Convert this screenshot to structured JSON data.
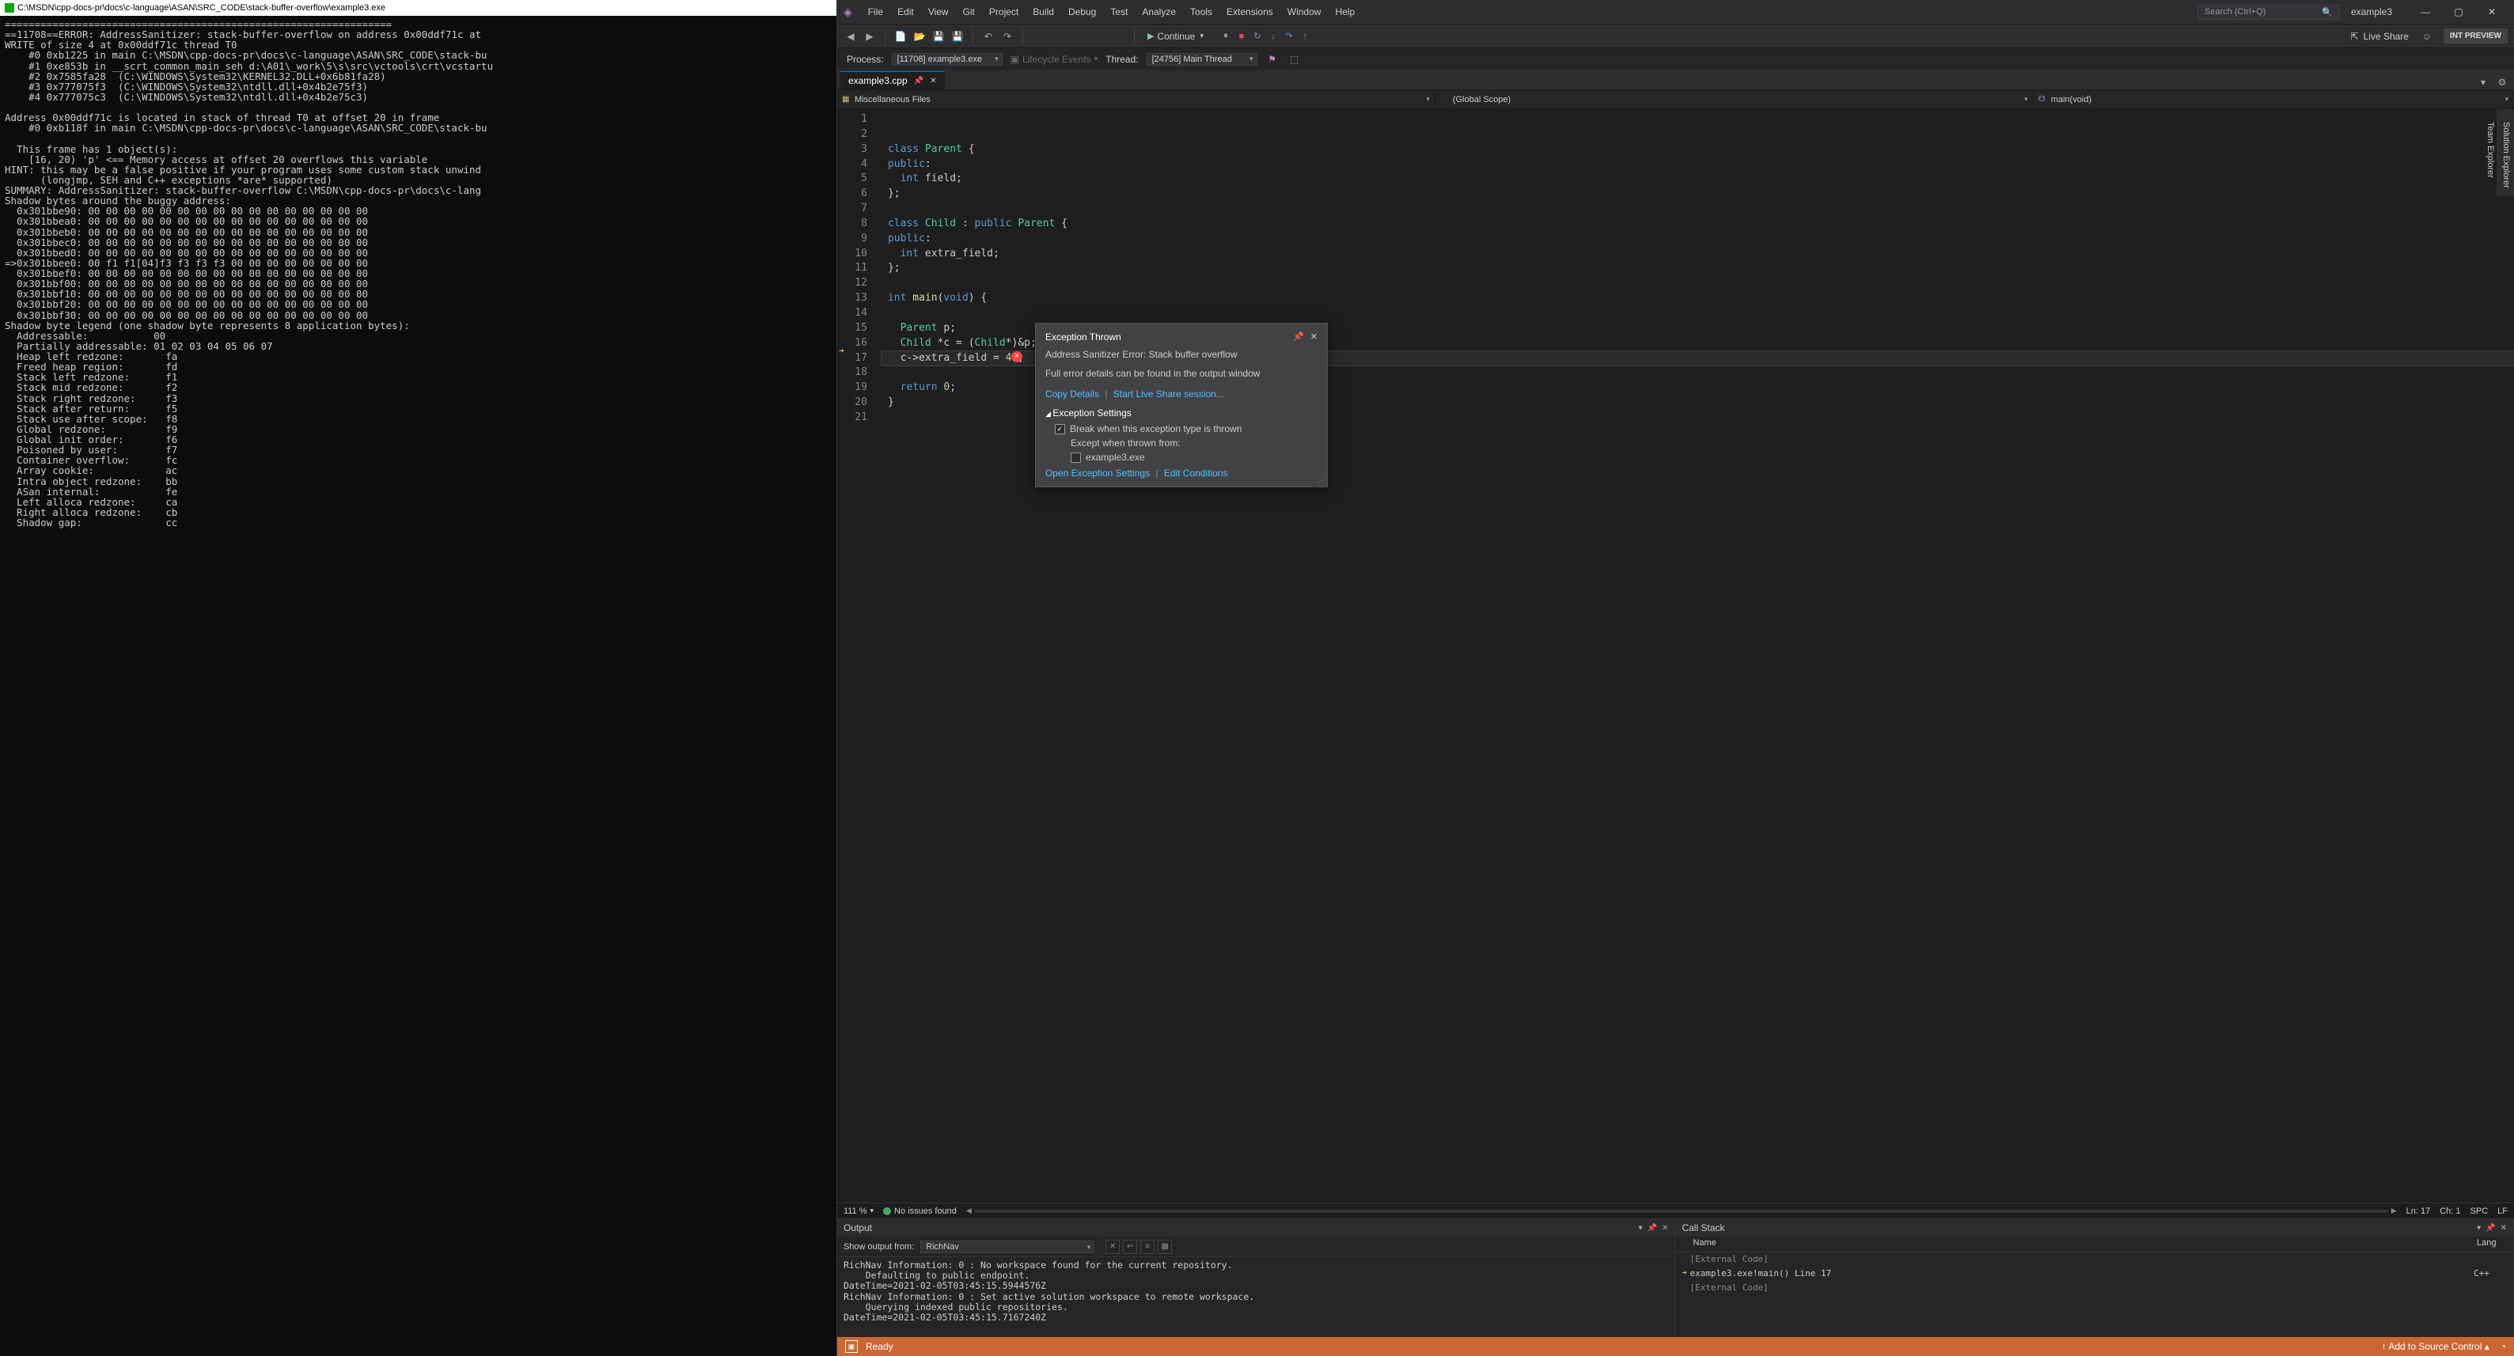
{
  "console": {
    "title": "C:\\MSDN\\cpp-docs-pr\\docs\\c-language\\ASAN\\SRC_CODE\\stack-buffer-overflow\\example3.exe",
    "body": "=================================================================\n==11708==ERROR: AddressSanitizer: stack-buffer-overflow on address 0x00ddf71c at \nWRITE of size 4 at 0x00ddf71c thread T0\n    #0 0xb1225 in main C:\\MSDN\\cpp-docs-pr\\docs\\c-language\\ASAN\\SRC_CODE\\stack-bu\n    #1 0xe853b in __scrt_common_main_seh d:\\A01\\_work\\5\\s\\src\\vctools\\crt\\vcstartu\n    #2 0x7585fa28  (C:\\WINDOWS\\System32\\KERNEL32.DLL+0x6b81fa28)\n    #3 0x777075f3  (C:\\WINDOWS\\System32\\ntdll.dll+0x4b2e75f3)\n    #4 0x777075c3  (C:\\WINDOWS\\System32\\ntdll.dll+0x4b2e75c3)\n\nAddress 0x00ddf71c is located in stack of thread T0 at offset 20 in frame\n    #0 0xb118f in main C:\\MSDN\\cpp-docs-pr\\docs\\c-language\\ASAN\\SRC_CODE\\stack-bu\n\n  This frame has 1 object(s):\n    [16, 20) 'p' <== Memory access at offset 20 overflows this variable\nHINT: this may be a false positive if your program uses some custom stack unwind\n      (longjmp, SEH and C++ exceptions *are* supported)\nSUMMARY: AddressSanitizer: stack-buffer-overflow C:\\MSDN\\cpp-docs-pr\\docs\\c-lang\nShadow bytes around the buggy address:\n  0x301bbe90: 00 00 00 00 00 00 00 00 00 00 00 00 00 00 00 00\n  0x301bbea0: 00 00 00 00 00 00 00 00 00 00 00 00 00 00 00 00\n  0x301bbeb0: 00 00 00 00 00 00 00 00 00 00 00 00 00 00 00 00\n  0x301bbec0: 00 00 00 00 00 00 00 00 00 00 00 00 00 00 00 00\n  0x301bbed0: 00 00 00 00 00 00 00 00 00 00 00 00 00 00 00 00\n=>0x301bbee0: 00 f1 f1[04]f3 f3 f3 f3 00 00 00 00 00 00 00 00\n  0x301bbef0: 00 00 00 00 00 00 00 00 00 00 00 00 00 00 00 00\n  0x301bbf00: 00 00 00 00 00 00 00 00 00 00 00 00 00 00 00 00\n  0x301bbf10: 00 00 00 00 00 00 00 00 00 00 00 00 00 00 00 00\n  0x301bbf20: 00 00 00 00 00 00 00 00 00 00 00 00 00 00 00 00\n  0x301bbf30: 00 00 00 00 00 00 00 00 00 00 00 00 00 00 00 00\nShadow byte legend (one shadow byte represents 8 application bytes):\n  Addressable:           00\n  Partially addressable: 01 02 03 04 05 06 07\n  Heap left redzone:       fa\n  Freed heap region:       fd\n  Stack left redzone:      f1\n  Stack mid redzone:       f2\n  Stack right redzone:     f3\n  Stack after return:      f5\n  Stack use after scope:   f8\n  Global redzone:          f9\n  Global init order:       f6\n  Poisoned by user:        f7\n  Container overflow:      fc\n  Array cookie:            ac\n  Intra object redzone:    bb\n  ASan internal:           fe\n  Left alloca redzone:     ca\n  Right alloca redzone:    cb\n  Shadow gap:              cc"
  },
  "vs": {
    "menu": [
      "File",
      "Edit",
      "View",
      "Git",
      "Project",
      "Build",
      "Debug",
      "Test",
      "Analyze",
      "Tools",
      "Extensions",
      "Window",
      "Help"
    ],
    "search_placeholder": "Search (Ctrl+Q)",
    "solution_name": "example3",
    "run_label": "Continue",
    "live_share": "Live Share",
    "int_preview": "INT PREVIEW",
    "process_label": "Process:",
    "process_value": "[11708] example3.exe",
    "lifecycle": "Lifecycle Events",
    "thread_label": "Thread:",
    "thread_value": "[24756] Main Thread",
    "tab_name": "example3.cpp",
    "nav": {
      "misc": "Miscellaneous Files",
      "scope": "(Global Scope)",
      "fn": "main(void)"
    },
    "code_lines": 21,
    "zoom": "111 %",
    "issues": "No issues found",
    "cursor": {
      "ln": "Ln: 17",
      "ch": "Ch: 1",
      "spc": "SPC",
      "lf": "LF"
    }
  },
  "exception": {
    "title": "Exception Thrown",
    "msg1": "Address Sanitizer Error: Stack buffer overflow",
    "msg2": "Full error details can be found in the output window",
    "link_copy": "Copy Details",
    "link_liveshare": "Start Live Share session...",
    "settings_h": "Exception Settings",
    "chk1": "Break when this exception type is thrown",
    "except_from": "Except when thrown from:",
    "chk2": "example3.exe",
    "link_open": "Open Exception Settings",
    "link_editcond": "Edit Conditions"
  },
  "output": {
    "title": "Output",
    "show_from": "Show output from:",
    "source": "RichNav",
    "body": "RichNav Information: 0 : No workspace found for the current repository.\n    Defaulting to public endpoint.\nDateTime=2021-02-05T03:45:15.5944576Z\nRichNav Information: 0 : Set active solution workspace to remote workspace.\n    Querying indexed public repositories.\nDateTime=2021-02-05T03:45:15.7167240Z"
  },
  "callstack": {
    "title": "Call Stack",
    "col_name": "Name",
    "col_lang": "Lang",
    "rows": [
      {
        "marker": "",
        "name": "[External Code]",
        "lang": "",
        "ext": true
      },
      {
        "marker": "➜",
        "name": "example3.exe!main() Line 17",
        "lang": "C++",
        "ext": false
      },
      {
        "marker": "",
        "name": "[External Code]",
        "lang": "",
        "ext": true
      }
    ]
  },
  "statusbar": {
    "ready": "Ready",
    "add_src": "Add to Source Control"
  },
  "side_tabs": [
    "Solution Explorer",
    "Team Explorer"
  ]
}
